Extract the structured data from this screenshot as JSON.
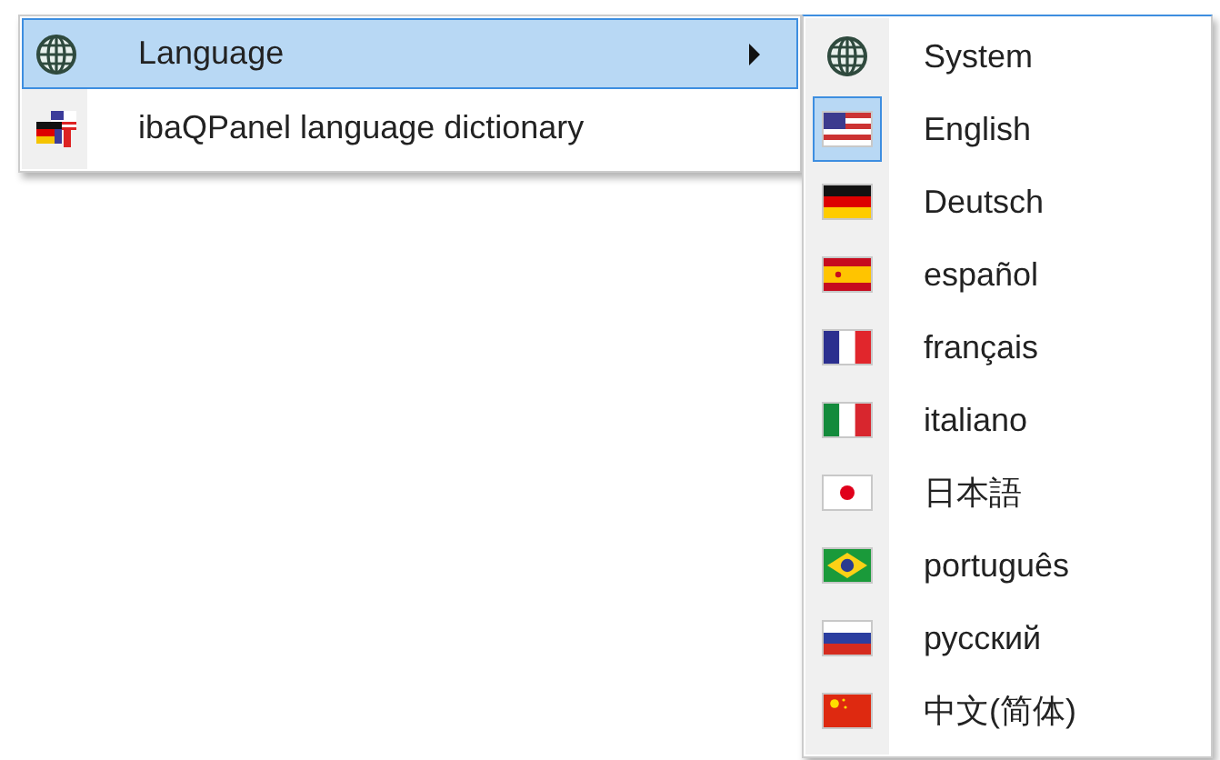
{
  "menu": {
    "items": [
      {
        "label": "Language",
        "kind": "globe",
        "selected": true,
        "submenu": true
      },
      {
        "label": "ibaQPanel language dictionary",
        "kind": "dict",
        "selected": false,
        "submenu": false
      }
    ]
  },
  "submenu": {
    "items": [
      {
        "label": "System",
        "kind": "globe",
        "checked": false
      },
      {
        "label": "English",
        "kind": "us",
        "checked": true
      },
      {
        "label": "Deutsch",
        "kind": "de",
        "checked": false
      },
      {
        "label": "español",
        "kind": "es",
        "checked": false
      },
      {
        "label": "français",
        "kind": "fr",
        "checked": false
      },
      {
        "label": "italiano",
        "kind": "it",
        "checked": false
      },
      {
        "label": "日本語",
        "kind": "jp",
        "checked": false
      },
      {
        "label": "português",
        "kind": "br",
        "checked": false
      },
      {
        "label": "русский",
        "kind": "ru",
        "checked": false
      },
      {
        "label": "中文(简体)",
        "kind": "cn",
        "checked": false
      }
    ]
  }
}
